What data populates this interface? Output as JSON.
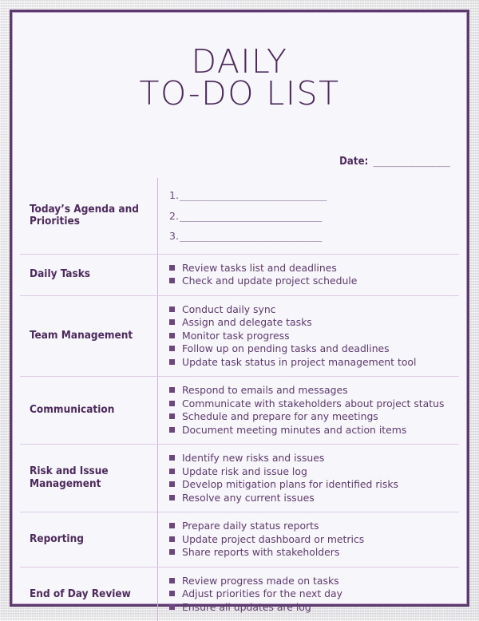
{
  "theme": {
    "border_color": "#5d3a6e",
    "title_color": "#4d2a5e",
    "text_color": "#5d3a6e",
    "bullet_color": "#6b4680",
    "divider_color": "#dcc9e4",
    "paper_color": "#f7f6fb",
    "backdrop_color": "#e9e8ea"
  },
  "title": {
    "line1": "DAILY",
    "line2": "TO-DO LIST"
  },
  "date_field": {
    "label": "Date:",
    "blank": "______________",
    "value": ""
  },
  "table": {
    "rows": [
      {
        "label": "Today’s Agenda and Priorities",
        "type": "numbered",
        "items": [
          {
            "number": "1.",
            "blank": "_____________________________",
            "value": ""
          },
          {
            "number": "2.",
            "blank": "____________________________",
            "value": ""
          },
          {
            "number": "3.",
            "blank": "____________________________",
            "value": ""
          }
        ]
      },
      {
        "label": "Daily Tasks",
        "type": "bullets",
        "items": [
          "Review tasks list and deadlines",
          "Check and update project schedule"
        ]
      },
      {
        "label": "Team Management",
        "type": "bullets",
        "items": [
          "Conduct daily sync",
          "Assign and delegate tasks",
          "Monitor task progress",
          "Follow up on pending tasks and deadlines",
          "Update task status in project management tool"
        ]
      },
      {
        "label": "Communication",
        "type": "bullets",
        "items": [
          "Respond to emails and messages",
          "Communicate with stakeholders about project status",
          "Schedule and prepare for any meetings",
          "Document meeting minutes and action items"
        ]
      },
      {
        "label": "Risk and Issue Management",
        "type": "bullets",
        "items": [
          "Identify new risks and issues",
          "Update risk and issue log",
          "Develop mitigation plans for identified risks",
          "Resolve any current issues"
        ]
      },
      {
        "label": "Reporting",
        "type": "bullets",
        "items": [
          "Prepare daily status reports",
          "Update project dashboard or metrics",
          "Share reports with stakeholders"
        ]
      },
      {
        "label": "End of Day Review",
        "type": "bullets",
        "items": [
          "Review progress made on tasks",
          "Adjust priorities for the next day",
          "Ensure all updates are log"
        ]
      }
    ]
  }
}
